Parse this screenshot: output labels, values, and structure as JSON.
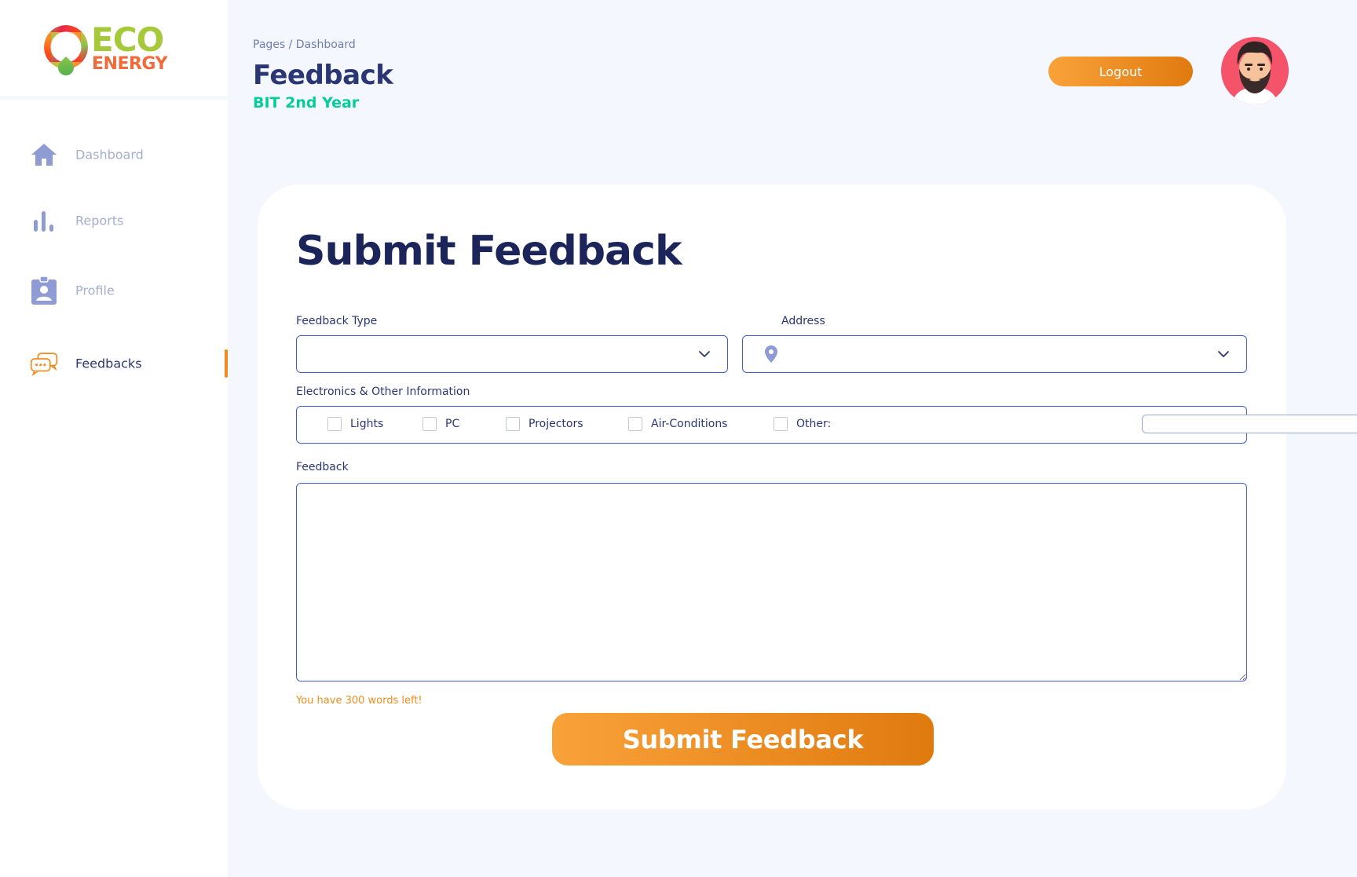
{
  "brand": {
    "line1": "ECO",
    "line2": "ENERGY"
  },
  "sidebar": {
    "items": [
      {
        "label": "Dashboard",
        "icon": "home-icon"
      },
      {
        "label": "Reports",
        "icon": "bar-chart-icon"
      },
      {
        "label": "Profile",
        "icon": "id-badge-icon"
      },
      {
        "label": "Feedbacks",
        "icon": "chat-bubbles-icon",
        "active": true
      }
    ]
  },
  "header": {
    "breadcrumb": "Pages / Dashboard",
    "title": "Feedback",
    "subtitle": "BIT 2nd Year",
    "logout_label": "Logout",
    "avatar_icon": "bearded-man-avatar"
  },
  "form": {
    "title": "Submit Feedback",
    "feedback_type_label": "Feedback Type",
    "feedback_type_value": "",
    "address_label": "Address",
    "address_value": "",
    "electronics_label": "Electronics & Other Information",
    "checkboxes": [
      {
        "label": "Lights",
        "checked": false
      },
      {
        "label": "PC",
        "checked": false
      },
      {
        "label": "Projectors",
        "checked": false
      },
      {
        "label": "Air-Conditions",
        "checked": false
      },
      {
        "label": "Other:",
        "checked": false
      }
    ],
    "other_value": "",
    "feedback_label": "Feedback",
    "feedback_value": "",
    "words_left": "You have 300 words left!",
    "submit_label": "Submit Feedback"
  },
  "colors": {
    "background": "#f4f7fe",
    "accent_orange": "#f08c1f",
    "subtitle_green": "#05cd99",
    "navy": "#2b3674",
    "input_border": "#3d5bd9"
  }
}
